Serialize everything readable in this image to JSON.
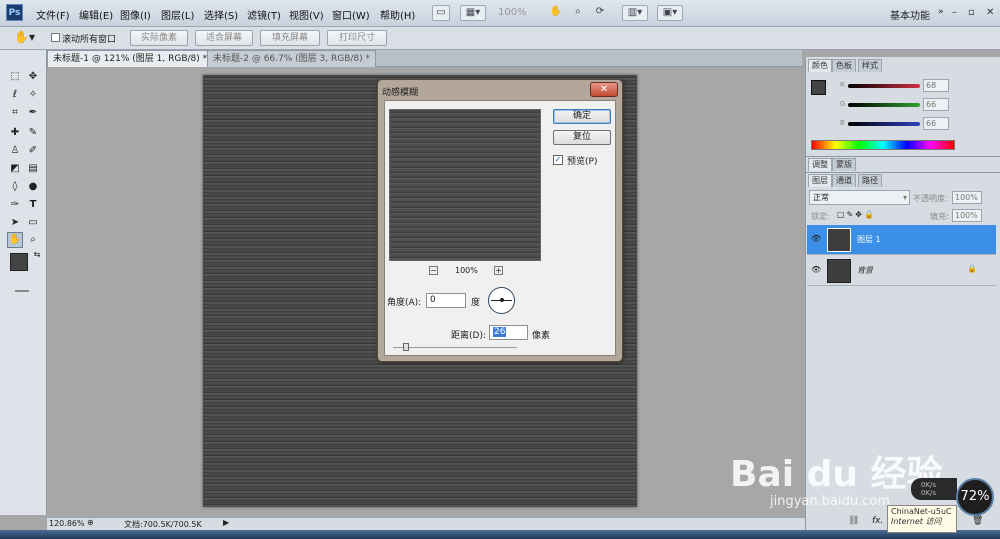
{
  "app": {
    "logo": "Ps"
  },
  "menus": [
    "文件(F)",
    "编辑(E)",
    "图像(I)",
    "图层(L)",
    "选择(S)",
    "滤镜(T)",
    "视图(V)",
    "窗口(W)",
    "帮助(H)"
  ],
  "menubar_zoom": "100%",
  "workspace": "基本功能",
  "options": {
    "scroll_all": "滚动所有窗口",
    "actual_pixels": "实际像素",
    "fit_screen": "适合屏幕",
    "fill_screen": "填充屏幕",
    "print_size": "打印尺寸"
  },
  "tabs": [
    {
      "label": "未标题-1 @ 121% (图层 1, RGB/8) *",
      "active": true
    },
    {
      "label": "未标题-2 @ 66.7% (图层 3, RGB/8) *",
      "active": false
    }
  ],
  "dialog": {
    "title": "动感模糊",
    "ok": "确定",
    "reset": "复位",
    "preview_label": "预览(P)",
    "preview_checked": true,
    "zoom": "100%",
    "zoom_out": "−",
    "zoom_in": "+",
    "angle_label": "角度(A):",
    "angle_value": "0",
    "angle_unit": "度",
    "distance_label": "距离(D):",
    "distance_value": "26",
    "distance_unit": "像素"
  },
  "color_panel": {
    "tabs": [
      "颜色",
      "色板",
      "样式"
    ],
    "r": "68",
    "g": "66",
    "b": "66",
    "r_label": "R",
    "g_label": "G",
    "b_label": "B",
    "r_color": "#d03040",
    "g_color": "#30a030",
    "b_color": "#3040c0"
  },
  "adjust_tabs": [
    "调整",
    "蒙版"
  ],
  "layers_panel": {
    "tabs": [
      "图层",
      "通道",
      "路径"
    ],
    "blend_mode": "正常",
    "opacity_label": "不透明度:",
    "opacity": "100%",
    "lock_label": "锁定:",
    "fill_label": "填充:",
    "fill": "100%",
    "layers": [
      {
        "name": "图层 1",
        "selected": true
      },
      {
        "name": "背景",
        "selected": false
      }
    ]
  },
  "status": {
    "zoom": "120.86%",
    "doc": "文档:700.5K/700.5K"
  },
  "watermark": {
    "brand": "Bai du 经验",
    "url": "jingyan.baidu.com"
  },
  "tooltip": {
    "line1": "ChinaNet-u5uC",
    "line2": "Internet 访问"
  },
  "net": {
    "up": "0K/s",
    "down": "0K/s",
    "gauge": "72%"
  }
}
